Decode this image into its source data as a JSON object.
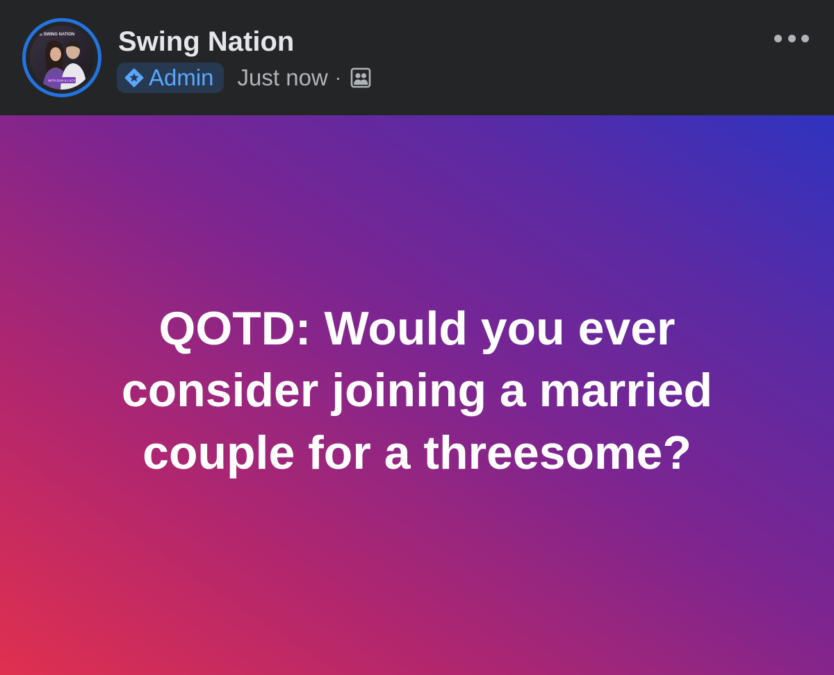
{
  "header": {
    "group_name": "Swing Nation",
    "badge_label": "Admin",
    "timestamp": "Just now",
    "separator": "·",
    "avatar_logo_text": "THE SWING NATION",
    "avatar_caption": "WITH DAN & LACY"
  },
  "post": {
    "text": "QOTD: Would you ever consider joining a married couple for a threesome?"
  },
  "icons": {
    "badge": "admin-star-icon",
    "audience": "group-members-icon",
    "more": "more-options-icon"
  },
  "colors": {
    "header_bg": "#242526",
    "avatar_ring": "#2374e1",
    "badge_bg": "#263951",
    "badge_text": "#5aa7ff",
    "meta_text": "#b0b3b8",
    "gradient_start": "#e0304f",
    "gradient_end": "#2f33c0"
  }
}
